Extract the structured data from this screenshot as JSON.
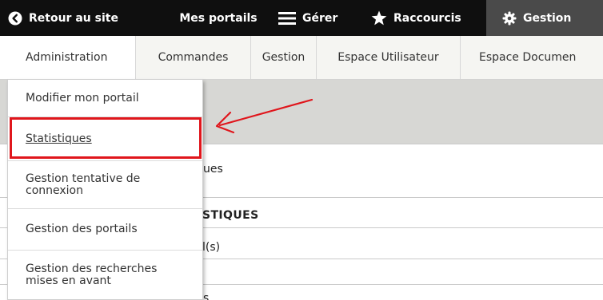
{
  "toolbar": {
    "back_label": "Retour au site",
    "portails_label": "Mes portails",
    "gerer_label": "Gérer",
    "raccourcis_label": "Raccourcis",
    "gestion_label": "Gestion"
  },
  "tabs": [
    {
      "label": "Administration"
    },
    {
      "label": "Commandes"
    },
    {
      "label": "Gestion"
    },
    {
      "label": "Espace Utilisateur"
    },
    {
      "label": "Espace Documen"
    }
  ],
  "dropdown": {
    "items": [
      {
        "label": "Modifier mon portail"
      },
      {
        "label": "Statistiques"
      },
      {
        "line1": "Gestion tentative de",
        "line2": "connexion"
      },
      {
        "label": "Gestion des portails"
      },
      {
        "line1": "Gestion des recherches",
        "line2": "mises en avant"
      }
    ]
  },
  "background": {
    "text_ues": "ues",
    "text_stiques": "STIQUES",
    "text_ls": "l(s)",
    "text_s": "s"
  },
  "colors": {
    "toolbar_bg": "#0f0f0f",
    "active_toolbar_bg": "#4a4a4a",
    "highlight": "#e0161c"
  }
}
